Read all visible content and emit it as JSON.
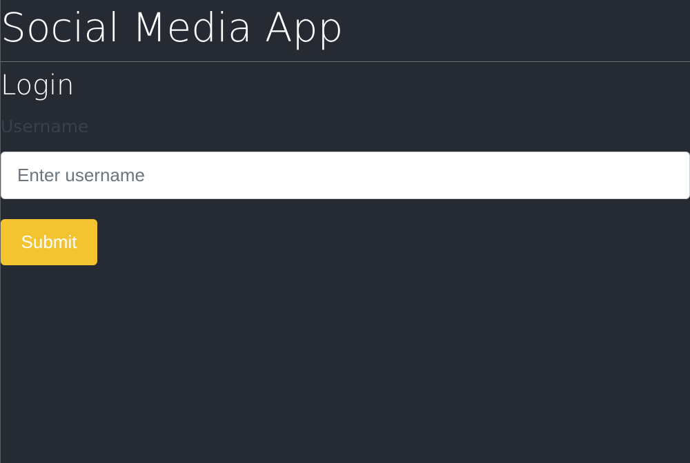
{
  "app": {
    "title": "Social Media App"
  },
  "login": {
    "title": "Login",
    "username_label": "Username",
    "username_placeholder": "Enter username",
    "username_value": "",
    "submit_label": "Submit"
  },
  "colors": {
    "background": "#252a33",
    "accent": "#f4c430",
    "input_background": "#ffffff",
    "label_text": "#3a404a"
  }
}
